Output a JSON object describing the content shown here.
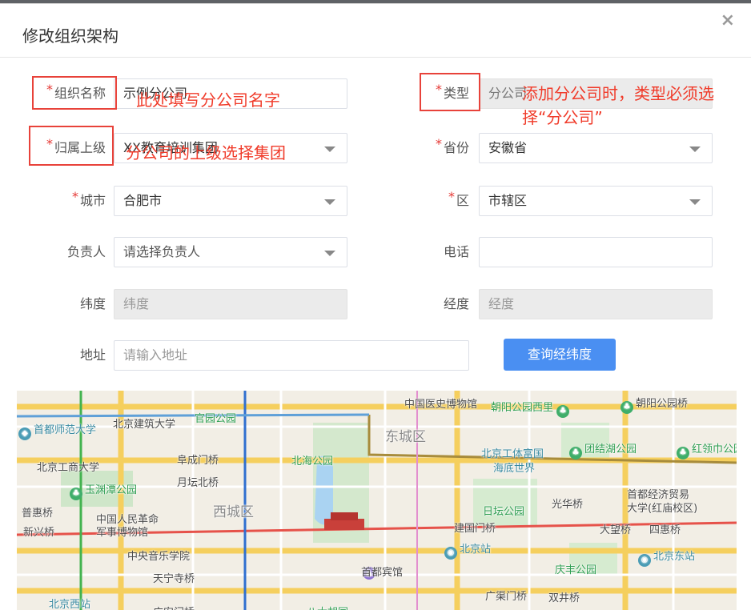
{
  "dialog": {
    "title": "修改组织架构",
    "close": "×"
  },
  "form": {
    "org_name": {
      "label": "组织名称",
      "value": "示例分公司"
    },
    "type": {
      "label": "类型",
      "value": "分公司"
    },
    "parent": {
      "label": "归属上级",
      "value": "XX教育培训集团"
    },
    "province": {
      "label": "省份",
      "value": "安徽省"
    },
    "city": {
      "label": "城市",
      "value": "合肥市"
    },
    "district": {
      "label": "区",
      "value": "市辖区"
    },
    "manager": {
      "label": "负责人",
      "placeholder": "请选择负责人"
    },
    "phone": {
      "label": "电话",
      "value": ""
    },
    "latitude": {
      "label": "纬度",
      "placeholder": "纬度"
    },
    "longitude": {
      "label": "经度",
      "placeholder": "经度"
    },
    "address": {
      "label": "地址",
      "placeholder": "请输入地址"
    },
    "required_mark": "*"
  },
  "buttons": {
    "query_coords": "查询经纬度"
  },
  "annotations": {
    "name_note": "此处填写分公司名字",
    "parent_note": "分公司的上级选择集团",
    "type_note_1": "添加分公司时，类型必须选",
    "type_note_2": "择“分公司”"
  },
  "map": {
    "labels": {
      "history_museum": "中国医史博物馆",
      "chaoyang_park_west": "朝阳公园西里",
      "chaoyang_park_bridge": "朝阳公园桥",
      "normal_univ": "首都师范大学",
      "arch_univ": "北京建筑大学",
      "guanyuan_park": "官园公园",
      "dongcheng": "东城区",
      "fuchengmen": "阜成门桥",
      "beihai_park": "北海公园",
      "workers_stadium": "北京工体富国",
      "ocean_world": "海底世界",
      "tuanjiehu_park": "团结湖公园",
      "honglingjin_park": "红领巾公园",
      "tech_univ": "北京工商大学",
      "yuetan_north": "月坛北桥",
      "yuyuantan_park": "玉渊潭公园",
      "xicheng": "西城区",
      "ritan_park": "日坛公园",
      "guanghua_bridge": "光华桥",
      "cueb": "首都经济贸易",
      "cueb_2": "大学(红庙校区)",
      "puhui_bridge": "普惠桥",
      "military_museum_1": "中国人民革命",
      "military_museum_2": "军事博物馆",
      "xinxing_bridge": "新兴桥",
      "jianguomen": "建国门桥",
      "dawang_bridge": "大望桥",
      "sihui_bridge": "四惠桥",
      "music_conservatory": "中央音乐学院",
      "beijing_station": "北京站",
      "beijing_east": "北京东站",
      "tianning_temple": "天宁寺桥",
      "capital_hotel": "首都宾馆",
      "qingfeng_park": "庆丰公园",
      "beijing_west": "北京西站",
      "guangqumen": "广渠门桥",
      "shuangjing": "双井桥",
      "guanganmen": "广安门桥",
      "bada_hutong": "八大胡同"
    }
  },
  "colors": {
    "primary": "#4a8ff2",
    "annotation_red": "#f03b2a",
    "required": "#e53935"
  }
}
